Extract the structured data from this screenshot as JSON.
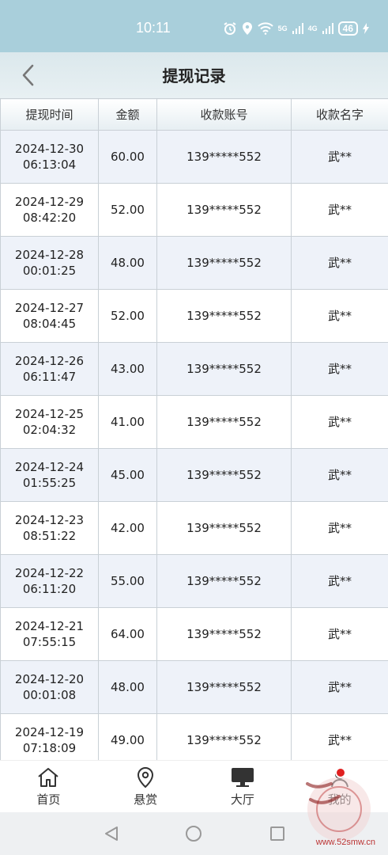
{
  "status_bar": {
    "time": "10:11",
    "net1": "5G",
    "net2": "4G",
    "battery": "46"
  },
  "header": {
    "title": "提现记录"
  },
  "table": {
    "columns": [
      "提现时间",
      "金额",
      "收款账号",
      "收款名字"
    ],
    "rows": [
      {
        "date": "2024-12-30",
        "time": "06:13:04",
        "amount": "60.00",
        "account": "139*****552",
        "name": "武**"
      },
      {
        "date": "2024-12-29",
        "time": "08:42:20",
        "amount": "52.00",
        "account": "139*****552",
        "name": "武**"
      },
      {
        "date": "2024-12-28",
        "time": "00:01:25",
        "amount": "48.00",
        "account": "139*****552",
        "name": "武**"
      },
      {
        "date": "2024-12-27",
        "time": "08:04:45",
        "amount": "52.00",
        "account": "139*****552",
        "name": "武**"
      },
      {
        "date": "2024-12-26",
        "time": "06:11:47",
        "amount": "43.00",
        "account": "139*****552",
        "name": "武**"
      },
      {
        "date": "2024-12-25",
        "time": "02:04:32",
        "amount": "41.00",
        "account": "139*****552",
        "name": "武**"
      },
      {
        "date": "2024-12-24",
        "time": "01:55:25",
        "amount": "45.00",
        "account": "139*****552",
        "name": "武**"
      },
      {
        "date": "2024-12-23",
        "time": "08:51:22",
        "amount": "42.00",
        "account": "139*****552",
        "name": "武**"
      },
      {
        "date": "2024-12-22",
        "time": "06:11:20",
        "amount": "55.00",
        "account": "139*****552",
        "name": "武**"
      },
      {
        "date": "2024-12-21",
        "time": "07:55:15",
        "amount": "64.00",
        "account": "139*****552",
        "name": "武**"
      },
      {
        "date": "2024-12-20",
        "time": "00:01:08",
        "amount": "48.00",
        "account": "139*****552",
        "name": "武**"
      },
      {
        "date": "2024-12-19",
        "time": "07:18:09",
        "amount": "49.00",
        "account": "139*****552",
        "name": "武**"
      }
    ]
  },
  "bottom_nav": {
    "items": [
      {
        "label": "首页",
        "icon": "home-icon"
      },
      {
        "label": "悬赏",
        "icon": "location-pin-icon"
      },
      {
        "label": "大厅",
        "icon": "monitor-icon"
      },
      {
        "label": "我的",
        "icon": "user-icon"
      }
    ]
  },
  "watermark": {
    "text": "www.52smw.cn"
  },
  "colors": {
    "status_bar": "#a9cfdb",
    "header": "#dbe8ec",
    "row_alt": "#eef2f9",
    "badge": "#e02020"
  }
}
